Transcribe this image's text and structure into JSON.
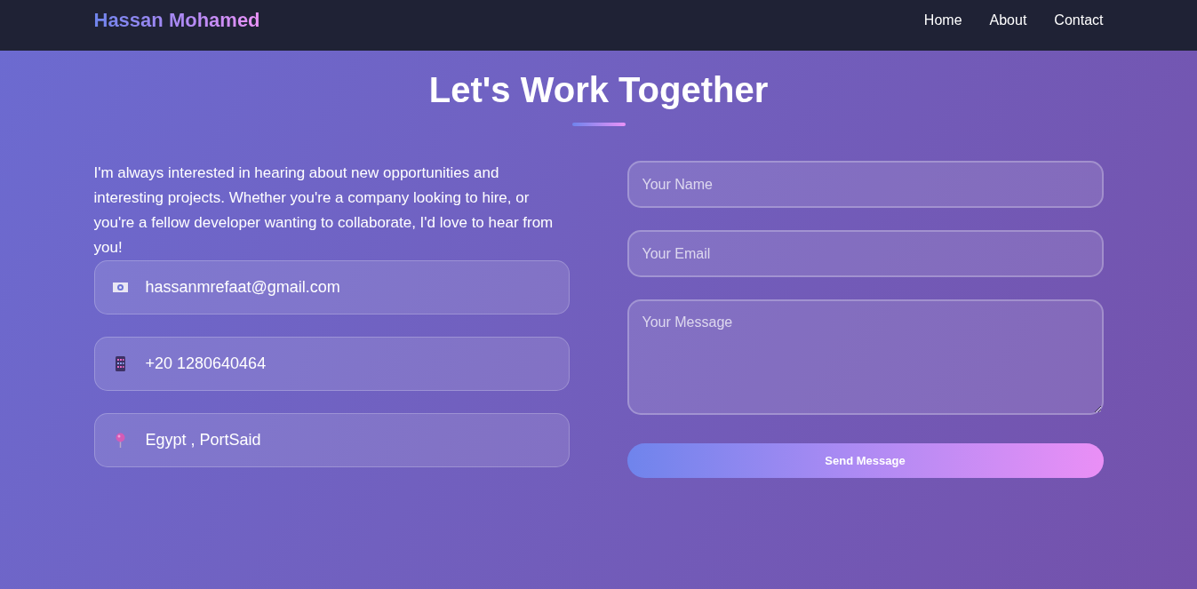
{
  "navbar": {
    "logo": "Hassan Mohamed",
    "links": [
      {
        "label": "Home"
      },
      {
        "label": "About"
      },
      {
        "label": "Contact"
      }
    ]
  },
  "section": {
    "title": "Let's Work Together"
  },
  "intro": "I'm always interested in hearing about new opportunities and interesting projects. Whether you're a company looking to hire, or you're a fellow developer wanting to collaborate, I'd love to hear from you!",
  "contact_items": [
    {
      "kind": "email",
      "text": "hassanmrefaat@gmail.com"
    },
    {
      "kind": "phone",
      "text": "+20 1280640464"
    },
    {
      "kind": "location",
      "text": "Egypt , PortSaid"
    }
  ],
  "form": {
    "fields": [
      {
        "kind": "text",
        "placeholder": "Your Name"
      },
      {
        "kind": "email",
        "placeholder": "Your Email"
      },
      {
        "kind": "textarea",
        "placeholder": "Your Message"
      }
    ],
    "submit": "Send Message"
  }
}
